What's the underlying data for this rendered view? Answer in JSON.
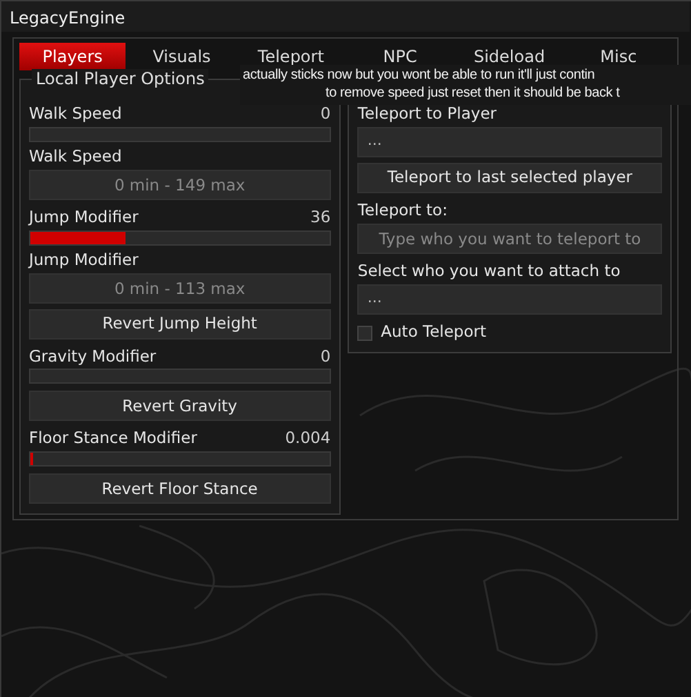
{
  "window": {
    "title": "LegacyEngine"
  },
  "tabs": [
    {
      "label": "Players",
      "selected": true
    },
    {
      "label": "Visuals",
      "selected": false
    },
    {
      "label": "Teleport",
      "selected": false
    },
    {
      "label": "NPC",
      "selected": false
    },
    {
      "label": "Sideload",
      "selected": false
    },
    {
      "label": "Misc",
      "selected": false
    }
  ],
  "local_player_options": {
    "title": "Local Player Options",
    "controls": [
      {
        "kind": "slider",
        "label": "Walk Speed",
        "reading": "0",
        "level": 0
      },
      {
        "kind": "label",
        "label": "Walk Speed"
      },
      {
        "kind": "field",
        "placeholder": "0 min - 149 max"
      },
      {
        "kind": "slider",
        "label": "Jump Modifier",
        "reading": "36",
        "level": 0.32
      },
      {
        "kind": "label",
        "label": "Jump Modifier"
      },
      {
        "kind": "field",
        "placeholder": "0 min - 113 max"
      },
      {
        "kind": "button",
        "label": "Revert Jump Height"
      },
      {
        "kind": "slider",
        "label": "Gravity Modifier",
        "reading": "0",
        "level": 0
      },
      {
        "kind": "button",
        "label": "Revert Gravity"
      },
      {
        "kind": "slider",
        "label": "Floor Stance Modifier",
        "reading": "0.004",
        "level": 0.01
      },
      {
        "kind": "button",
        "label": "Revert Floor Stance"
      }
    ]
  },
  "online_player_options": {
    "controls": [
      {
        "kind": "label",
        "label": "Teleport to Player"
      },
      {
        "kind": "dropdown",
        "value": "..."
      },
      {
        "kind": "button",
        "label": "Teleport to last selected player"
      },
      {
        "kind": "label",
        "label": "Teleport to:"
      },
      {
        "kind": "field",
        "placeholder": "Type who you want to teleport to"
      },
      {
        "kind": "label",
        "label": "Select who you want to attach to"
      },
      {
        "kind": "dropdown",
        "value": "..."
      },
      {
        "kind": "checkbox",
        "label": "Auto Teleport",
        "checked": false
      }
    ]
  },
  "tooltip": {
    "lines": [
      "actually sticks now but you wont be able to run it'll just contin",
      "to remove speed just reset then it should be back t"
    ]
  }
}
